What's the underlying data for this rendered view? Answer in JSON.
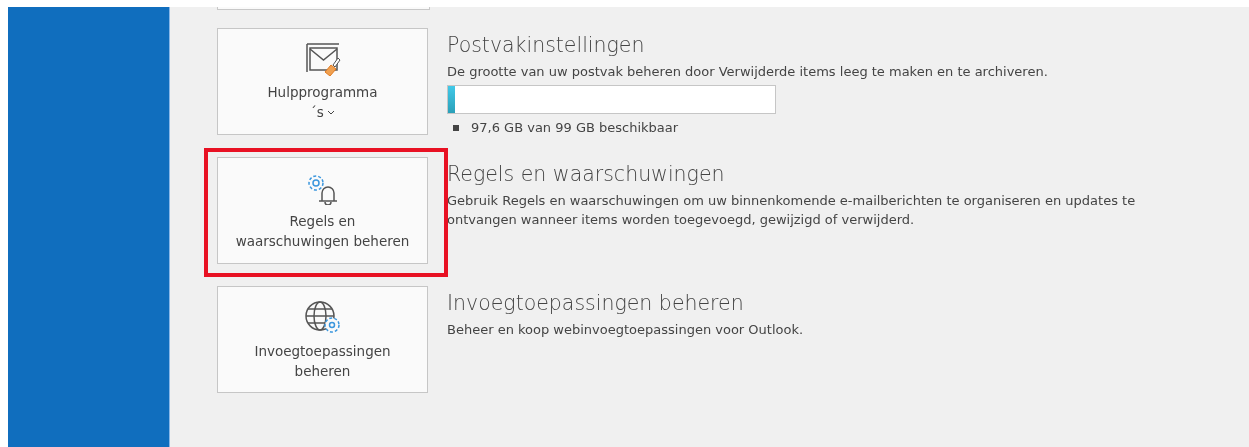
{
  "sections": [
    {
      "kind": "cleanup",
      "button": {
        "lines": [
          "Hulpprogramma",
          "´s"
        ],
        "dropdown": true
      },
      "highlighted": false,
      "title": "Postvakinstellingen",
      "description": "De grootte van uw postvak beheren door Verwijderde items leeg te maken en te archiveren.",
      "storage": {
        "level": 0.02,
        "caption": "97,6 GB van 99 GB beschikbaar"
      }
    },
    {
      "kind": "rules",
      "button": {
        "lines": [
          "Regels en",
          "waarschuwingen beheren"
        ],
        "dropdown": false
      },
      "highlighted": true,
      "title": "Regels en waarschuwingen",
      "description": "Gebruik Regels en waarschuwingen om uw binnenkomende e-mailberichten te organiseren en updates te ontvangen wanneer items worden toegevoegd, gewijzigd of verwijderd."
    },
    {
      "kind": "addins",
      "button": {
        "lines": [
          "Invoegtoepassingen",
          "beheren"
        ],
        "dropdown": false
      },
      "highlighted": false,
      "title": "Invoegtoepassingen beheren",
      "description": "Beheer en koop webinvoegtoepassingen voor Outlook."
    }
  ]
}
